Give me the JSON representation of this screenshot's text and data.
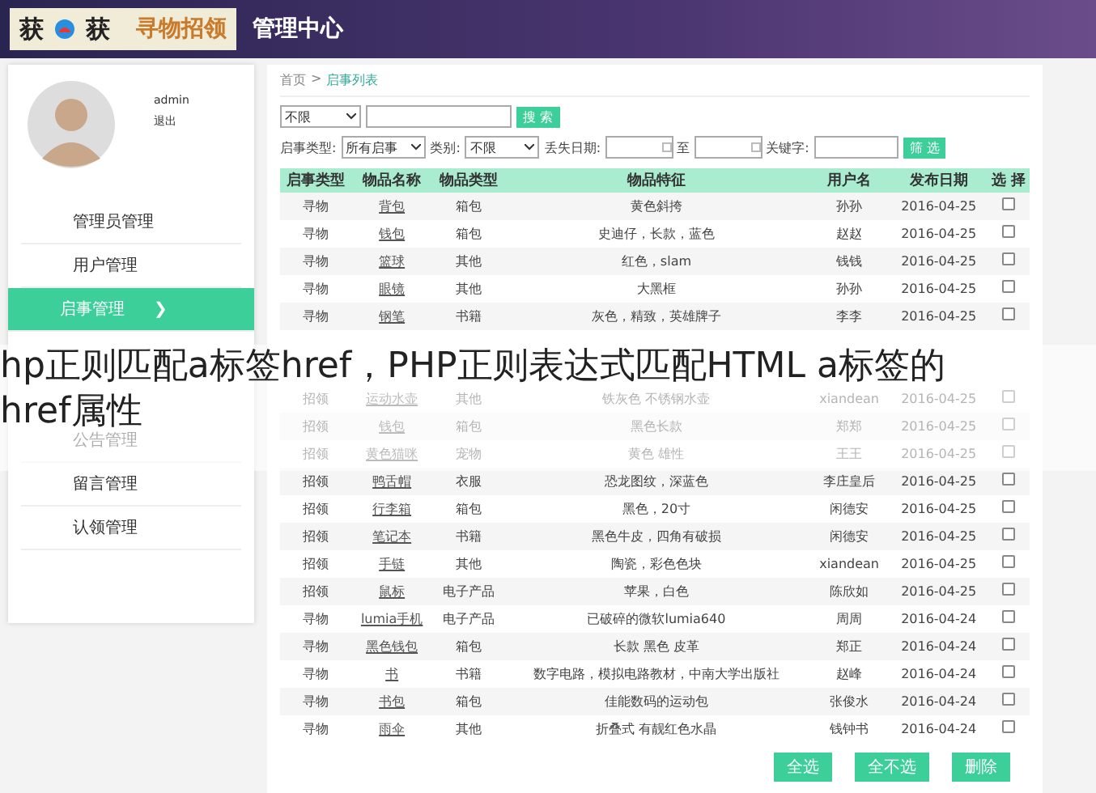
{
  "header": {
    "logo_text": "获",
    "logo_text_2": "获",
    "brand": "寻物招领",
    "title": "管理中心"
  },
  "user": {
    "name": "admin",
    "logout": "退出"
  },
  "sidebar": {
    "items": [
      {
        "label": "管理员管理",
        "selected": false
      },
      {
        "label": "用户管理",
        "selected": false
      },
      {
        "label": "启事管理",
        "selected": true,
        "arrow": "❯"
      }
    ],
    "items_below_caption": [
      {
        "label": "公告管理",
        "selected": false
      },
      {
        "label": "留言管理",
        "selected": false
      },
      {
        "label": "认领管理",
        "selected": false
      }
    ]
  },
  "breadcrumb": {
    "home": "首页",
    "separator": ">",
    "current": "启事列表"
  },
  "search": {
    "scope": "不限",
    "button": "搜 索"
  },
  "filters": {
    "type_label": "启事类型:",
    "type_value": "所有启事",
    "category_label": "类别:",
    "category_value": "不限",
    "date_label": "丢失日期:",
    "date_to": "至",
    "keyword_label": "关键字:",
    "button": "筛 选"
  },
  "table": {
    "columns": [
      "启事类型",
      "物品名称",
      "物品类型",
      "物品特征",
      "用户名",
      "发布日期",
      "选 择"
    ],
    "rows": [
      {
        "cells": [
          "寻物",
          "背包",
          "箱包",
          "黄色斜挎",
          "孙孙",
          "2016-04-25"
        ],
        "checked": false
      },
      {
        "cells": [
          "寻物",
          "钱包",
          "箱包",
          "史迪仔，长款，蓝色",
          "赵赵",
          "2016-04-25"
        ],
        "checked": false
      },
      {
        "cells": [
          "寻物",
          "篮球",
          "其他",
          "红色，slam",
          "钱钱",
          "2016-04-25"
        ],
        "checked": false
      },
      {
        "cells": [
          "寻物",
          "眼镜",
          "其他",
          "大黑框",
          "孙孙",
          "2016-04-25"
        ],
        "checked": false
      },
      {
        "cells": [
          "寻物",
          "钢笔",
          "书籍",
          "灰色，精致，英雄牌子",
          "李李",
          "2016-04-25"
        ],
        "checked": false
      }
    ],
    "rows_below_caption": [
      {
        "cells": [
          "招领",
          "运动水壶",
          "其他",
          "铁灰色 不锈钢水壶",
          "xiandean",
          "2016-04-25"
        ],
        "checked": false
      },
      {
        "cells": [
          "招领",
          "钱包",
          "箱包",
          "黑色长款",
          "郑郑",
          "2016-04-25"
        ],
        "checked": false
      },
      {
        "cells": [
          "招领",
          "黄色猫咪",
          "宠物",
          "黄色 雄性",
          "王王",
          "2016-04-25"
        ],
        "checked": false
      },
      {
        "cells": [
          "招领",
          "鸭舌帽",
          "衣服",
          "恐龙图纹，深蓝色",
          "李庄皇后",
          "2016-04-25"
        ],
        "checked": false
      },
      {
        "cells": [
          "招领",
          "行李箱",
          "箱包",
          "黑色，20寸",
          "闲德安",
          "2016-04-25"
        ],
        "checked": false
      },
      {
        "cells": [
          "招领",
          "笔记本",
          "书籍",
          "黑色牛皮，四角有破损",
          "闲德安",
          "2016-04-25"
        ],
        "checked": false
      },
      {
        "cells": [
          "招领",
          "手链",
          "其他",
          "陶瓷，彩色色块",
          "xiandean",
          "2016-04-25"
        ],
        "checked": false
      },
      {
        "cells": [
          "招领",
          "鼠标",
          "电子产品",
          "苹果，白色",
          "陈欣如",
          "2016-04-25"
        ],
        "checked": false
      },
      {
        "cells": [
          "寻物",
          "lumia手机",
          "电子产品",
          "已破碎的微软lumia640",
          "周周",
          "2016-04-24"
        ],
        "checked": false
      },
      {
        "cells": [
          "寻物",
          "黑色钱包",
          "箱包",
          "长款 黑色 皮革",
          "郑正",
          "2016-04-24"
        ],
        "checked": false
      },
      {
        "cells": [
          "寻物",
          "书",
          "书籍",
          "数字电路，模拟电路教材，中南大学出版社",
          "赵峰",
          "2016-04-24"
        ],
        "checked": false
      },
      {
        "cells": [
          "寻物",
          "书包",
          "箱包",
          "佳能数码的运动包",
          "张俊水",
          "2016-04-24"
        ],
        "checked": false
      },
      {
        "cells": [
          "寻物",
          "雨伞",
          "其他",
          "折叠式 有靓红色水晶",
          "钱钟书",
          "2016-04-24"
        ],
        "checked": false
      }
    ]
  },
  "actions": [
    "全选",
    "全不选",
    "删除"
  ],
  "caption": {
    "lines": [
      "hp正则匹配a标签href，PHP正则表达式匹配HTML a标签的",
      "href属性"
    ]
  }
}
